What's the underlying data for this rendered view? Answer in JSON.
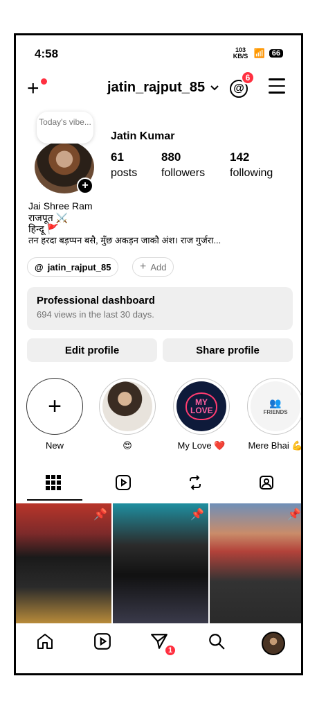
{
  "status_bar": {
    "time": "4:58",
    "speed": "103 KB/S",
    "battery": "66"
  },
  "header": {
    "username": "jatin_rajput_85",
    "threads_badge": "6"
  },
  "profile": {
    "note": "Today's vibe...",
    "full_name": "Jatin Kumar",
    "posts_count": "61",
    "posts_label": "posts",
    "followers_count": "880",
    "followers_label": "followers",
    "following_count": "142",
    "following_label": "following",
    "bio": [
      "Jai Shree Ram",
      "राजपूत ⚔️",
      "हिन्दू 🚩",
      "तन हरदा बड़प्पन बसै, मुँछ अकड़न जाकौ अंश। राज गुर्जरा..."
    ],
    "threads_chip": "jatin_rajput_85",
    "add_chip": "Add"
  },
  "dashboard": {
    "title": "Professional dashboard",
    "subtitle": "694 views in the last 30 days."
  },
  "buttons": {
    "edit": "Edit profile",
    "share": "Share profile"
  },
  "highlights": [
    {
      "label": "New"
    },
    {
      "label": "😍"
    },
    {
      "label": "My Love ❤️"
    },
    {
      "label": "Mere Bhai 💪"
    }
  ],
  "highlight_texts": {
    "my_love": "MY LOVE",
    "friends": "FRIENDS"
  },
  "tabs": [
    "grid-icon",
    "reels-icon",
    "reposts-icon",
    "tagged-icon"
  ],
  "nav": {
    "notif_badge": "1"
  },
  "colors": {
    "badge": "#ff3040",
    "surface": "#efefef",
    "muted": "#737373"
  }
}
